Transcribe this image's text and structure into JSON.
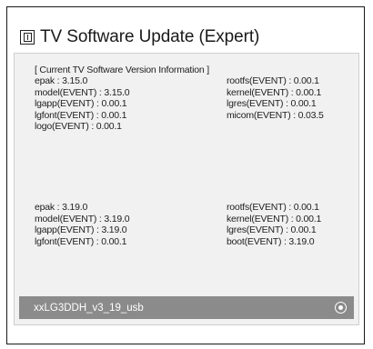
{
  "header": {
    "title": "TV Software Update (Expert)",
    "icon": "info-box-icon"
  },
  "current_info": {
    "heading": "[ Current TV Software Version Information ]",
    "left": [
      "epak : 3.15.0",
      "model(EVENT) : 3.15.0",
      "lgapp(EVENT) : 0.00.1",
      "lgfont(EVENT) : 0.00.1",
      "logo(EVENT) : 0.00.1"
    ],
    "right": [
      "rootfs(EVENT) : 0.00.1",
      "kernel(EVENT) : 0.00.1",
      "lgres(EVENT) : 0.00.1",
      "micom(EVENT) : 0.03.5"
    ]
  },
  "update_info": {
    "left": [
      "epak : 3.19.0",
      "model(EVENT) : 3.19.0",
      "lgapp(EVENT) : 3.19.0",
      "lgfont(EVENT) : 0.00.1"
    ],
    "right": [
      "rootfs(EVENT) : 0.00.1",
      "kernel(EVENT) : 0.00.1",
      "lgres(EVENT) : 0.00.1",
      "boot(EVENT) : 3.19.0"
    ]
  },
  "file_list": {
    "selected_file": "xxLG3DDH_v3_19_usb",
    "selected": true
  },
  "colors": {
    "file_row_bg": "#8b8b8b",
    "panel_bg": "#f1f1f1"
  }
}
